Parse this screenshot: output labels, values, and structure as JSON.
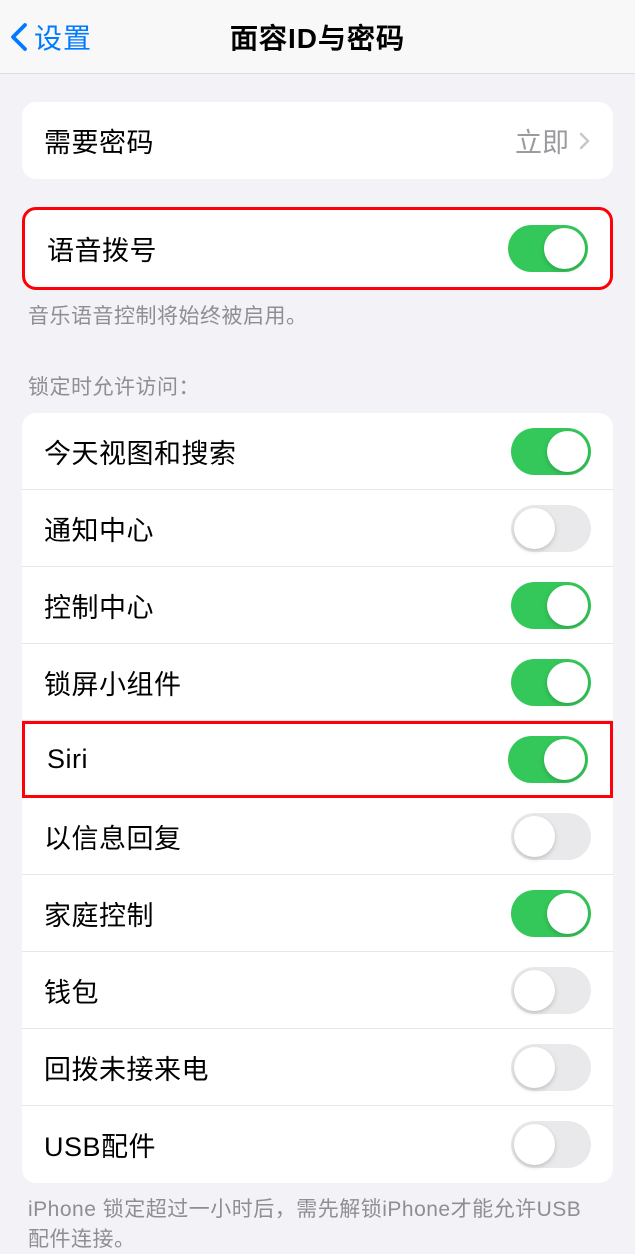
{
  "header": {
    "back_label": "设置",
    "title": "面容ID与密码"
  },
  "passcode": {
    "label": "需要密码",
    "value": "立即"
  },
  "voice_dial": {
    "label": "语音拨号",
    "footer": "音乐语音控制将始终被启用。",
    "on": true
  },
  "lock_caption": "锁定时允许访问：",
  "lock_items": [
    {
      "label": "今天视图和搜索",
      "on": true
    },
    {
      "label": "通知中心",
      "on": false
    },
    {
      "label": "控制中心",
      "on": true
    },
    {
      "label": "锁屏小组件",
      "on": true
    },
    {
      "label": "Siri",
      "on": true
    },
    {
      "label": "以信息回复",
      "on": false
    },
    {
      "label": "家庭控制",
      "on": true
    },
    {
      "label": "钱包",
      "on": false
    },
    {
      "label": "回拨未接来电",
      "on": false
    },
    {
      "label": "USB配件",
      "on": false
    }
  ],
  "usb_footer": "iPhone 锁定超过一小时后，需先解锁iPhone才能允许USB 配件连接。"
}
